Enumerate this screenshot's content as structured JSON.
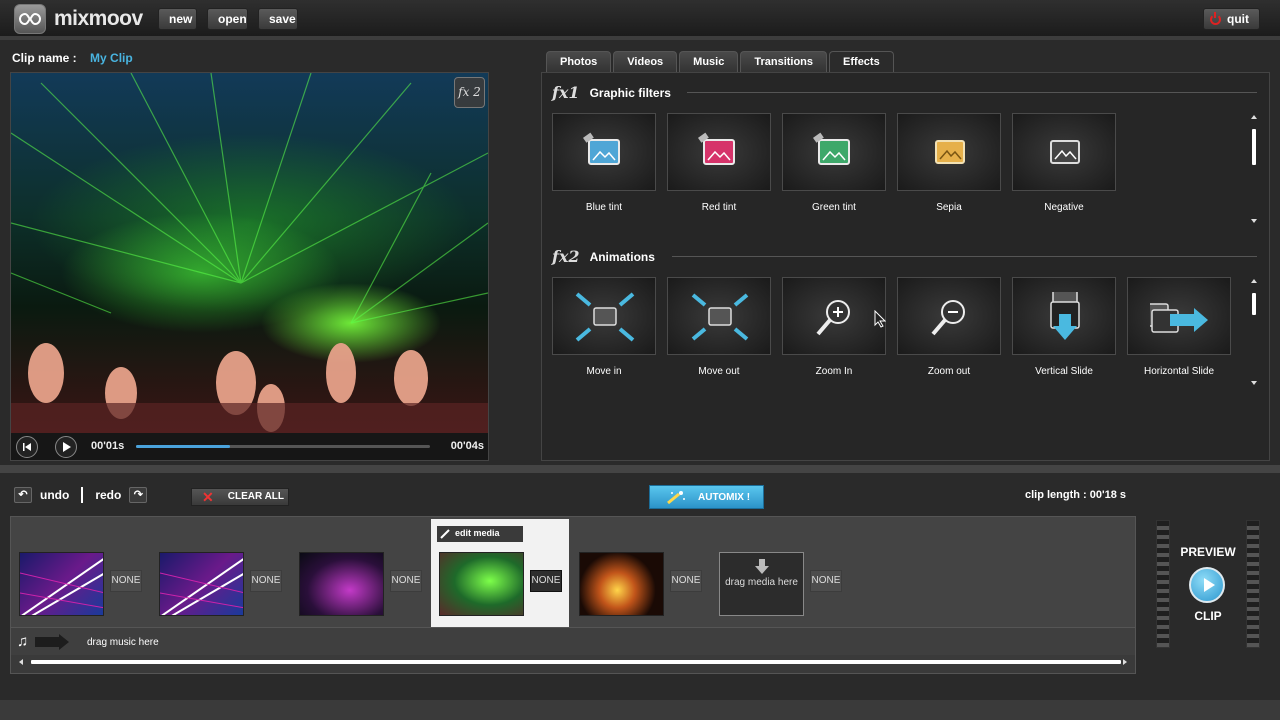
{
  "app": {
    "logo_text": "mixmoov"
  },
  "toolbar": {
    "new_label": "new",
    "open_label": "open",
    "save_label": "save",
    "quit_label": "quit"
  },
  "clip": {
    "name_label": "Clip name  :",
    "name_value": "My Clip"
  },
  "player": {
    "badge": "fx 2",
    "current_time": "00'01s",
    "total_time": "00'04s",
    "progress": 0.32
  },
  "tabs": [
    {
      "label": "Photos",
      "active": false
    },
    {
      "label": "Videos",
      "active": false
    },
    {
      "label": "Music",
      "active": false
    },
    {
      "label": "Transitions",
      "active": false
    },
    {
      "label": "Effects",
      "active": true
    }
  ],
  "effects": {
    "graphic": {
      "mark": "fx1",
      "title": "Graphic filters",
      "items": [
        {
          "label": "Blue tint",
          "icon": "blue-tint-icon",
          "color": "#4fa6d6"
        },
        {
          "label": "Red tint",
          "icon": "red-tint-icon",
          "color": "#d6336a"
        },
        {
          "label": "Green tint",
          "icon": "green-tint-icon",
          "color": "#3ea86a"
        },
        {
          "label": "Sepia",
          "icon": "sepia-icon",
          "color": "#e6b04a"
        },
        {
          "label": "Negative",
          "icon": "negative-icon",
          "color": "#cfcfcf"
        }
      ]
    },
    "animations": {
      "mark": "fx2",
      "title": "Animations",
      "items": [
        {
          "label": "Move in",
          "icon": "move-in-icon"
        },
        {
          "label": "Move out",
          "icon": "move-out-icon"
        },
        {
          "label": "Zoom In",
          "icon": "zoom-in-icon"
        },
        {
          "label": "Zoom out",
          "icon": "zoom-out-icon"
        },
        {
          "label": "Vertical Slide",
          "icon": "vertical-slide-icon"
        },
        {
          "label": "Horizontal Slide",
          "icon": "horizontal-slide-icon"
        }
      ]
    }
  },
  "timeline_toolbar": {
    "undo_label": "undo",
    "redo_label": "redo",
    "clear_all_label": "CLEAR ALL",
    "automix_label": "AUTOMIX !",
    "clip_length": "clip length : 00'18 s"
  },
  "timeline": {
    "transition_label": "NONE",
    "edit_media_label": "edit media",
    "drop_label": "drag media here",
    "music_label": "drag music here"
  },
  "preview": {
    "top_label": "PREVIEW",
    "bottom_label": "CLIP"
  },
  "colors": {
    "accent": "#49b4e0",
    "automix": "#3aaee0",
    "quit_power": "#dd2222"
  }
}
